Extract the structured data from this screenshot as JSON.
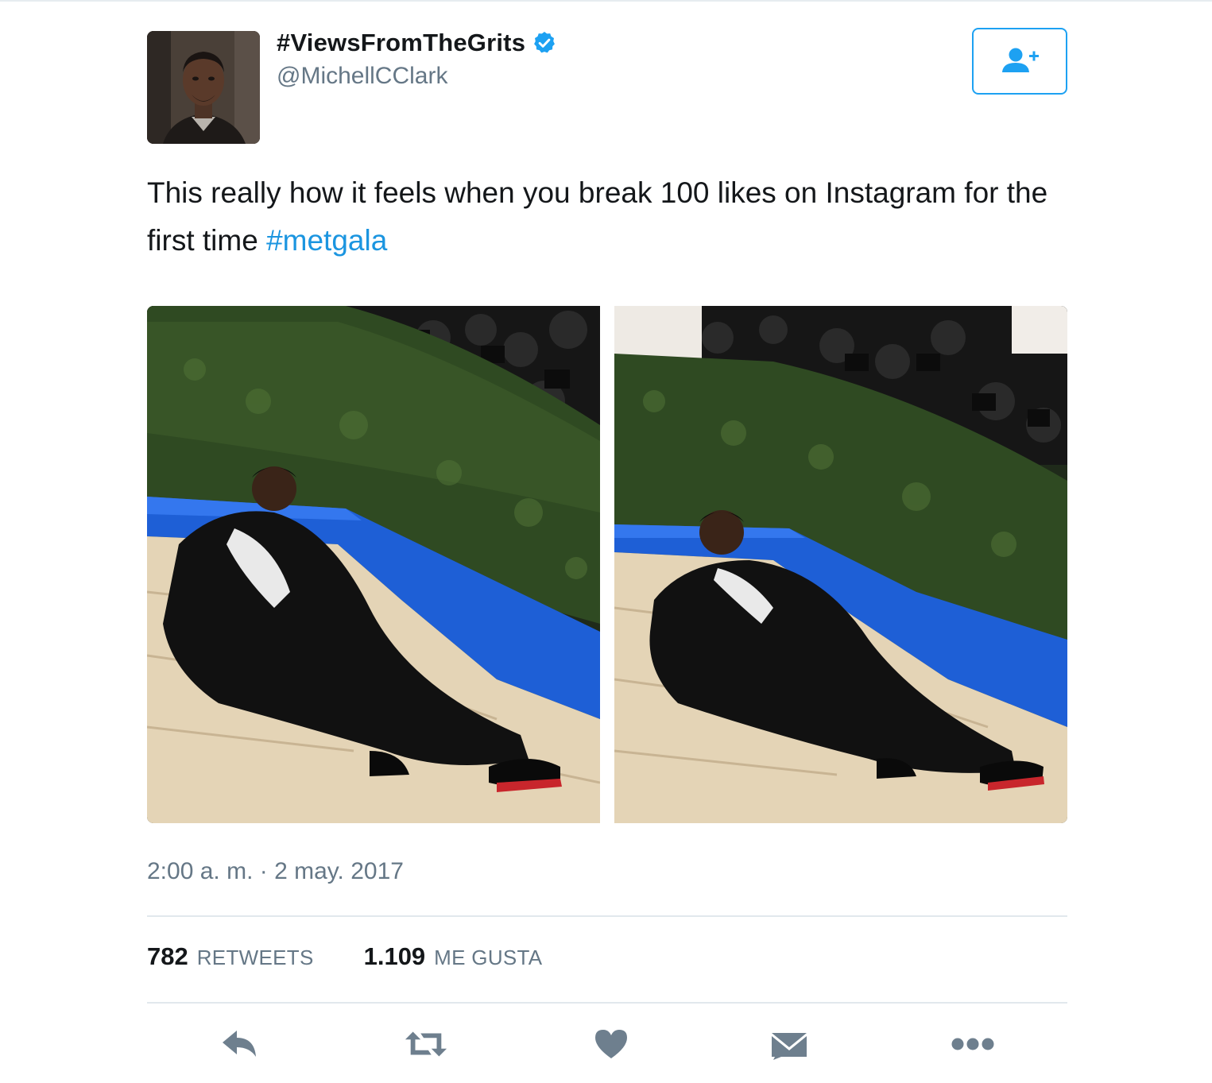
{
  "user": {
    "display_name": "#ViewsFromTheGrits",
    "handle": "@MichellCClark",
    "verified": true,
    "avatar_icon": "profile-photo"
  },
  "follow_button": {
    "icon": "follow-user-icon"
  },
  "tweet": {
    "text_before_hashtag": "This really how it feels when you break 100 likes on Instagram for the first time ",
    "hashtag": "#metgala",
    "timestamp": "2:00 a. m. · 2 may. 2017"
  },
  "media": [
    {
      "description_icon": "photo-left"
    },
    {
      "description_icon": "photo-right"
    }
  ],
  "stats": {
    "retweets_count": "782",
    "retweets_label": "RETWEETS",
    "likes_count": "1.109",
    "likes_label": "ME GUSTA"
  },
  "actions": {
    "reply_icon": "reply-icon",
    "retweet_icon": "retweet-icon",
    "like_icon": "heart-icon",
    "dm_icon": "envelope-icon",
    "more_icon": "more-icon"
  },
  "colors": {
    "accent": "#1da1f2",
    "link": "#1b95e0",
    "muted": "#657786",
    "icon": "#6e7f8e"
  }
}
